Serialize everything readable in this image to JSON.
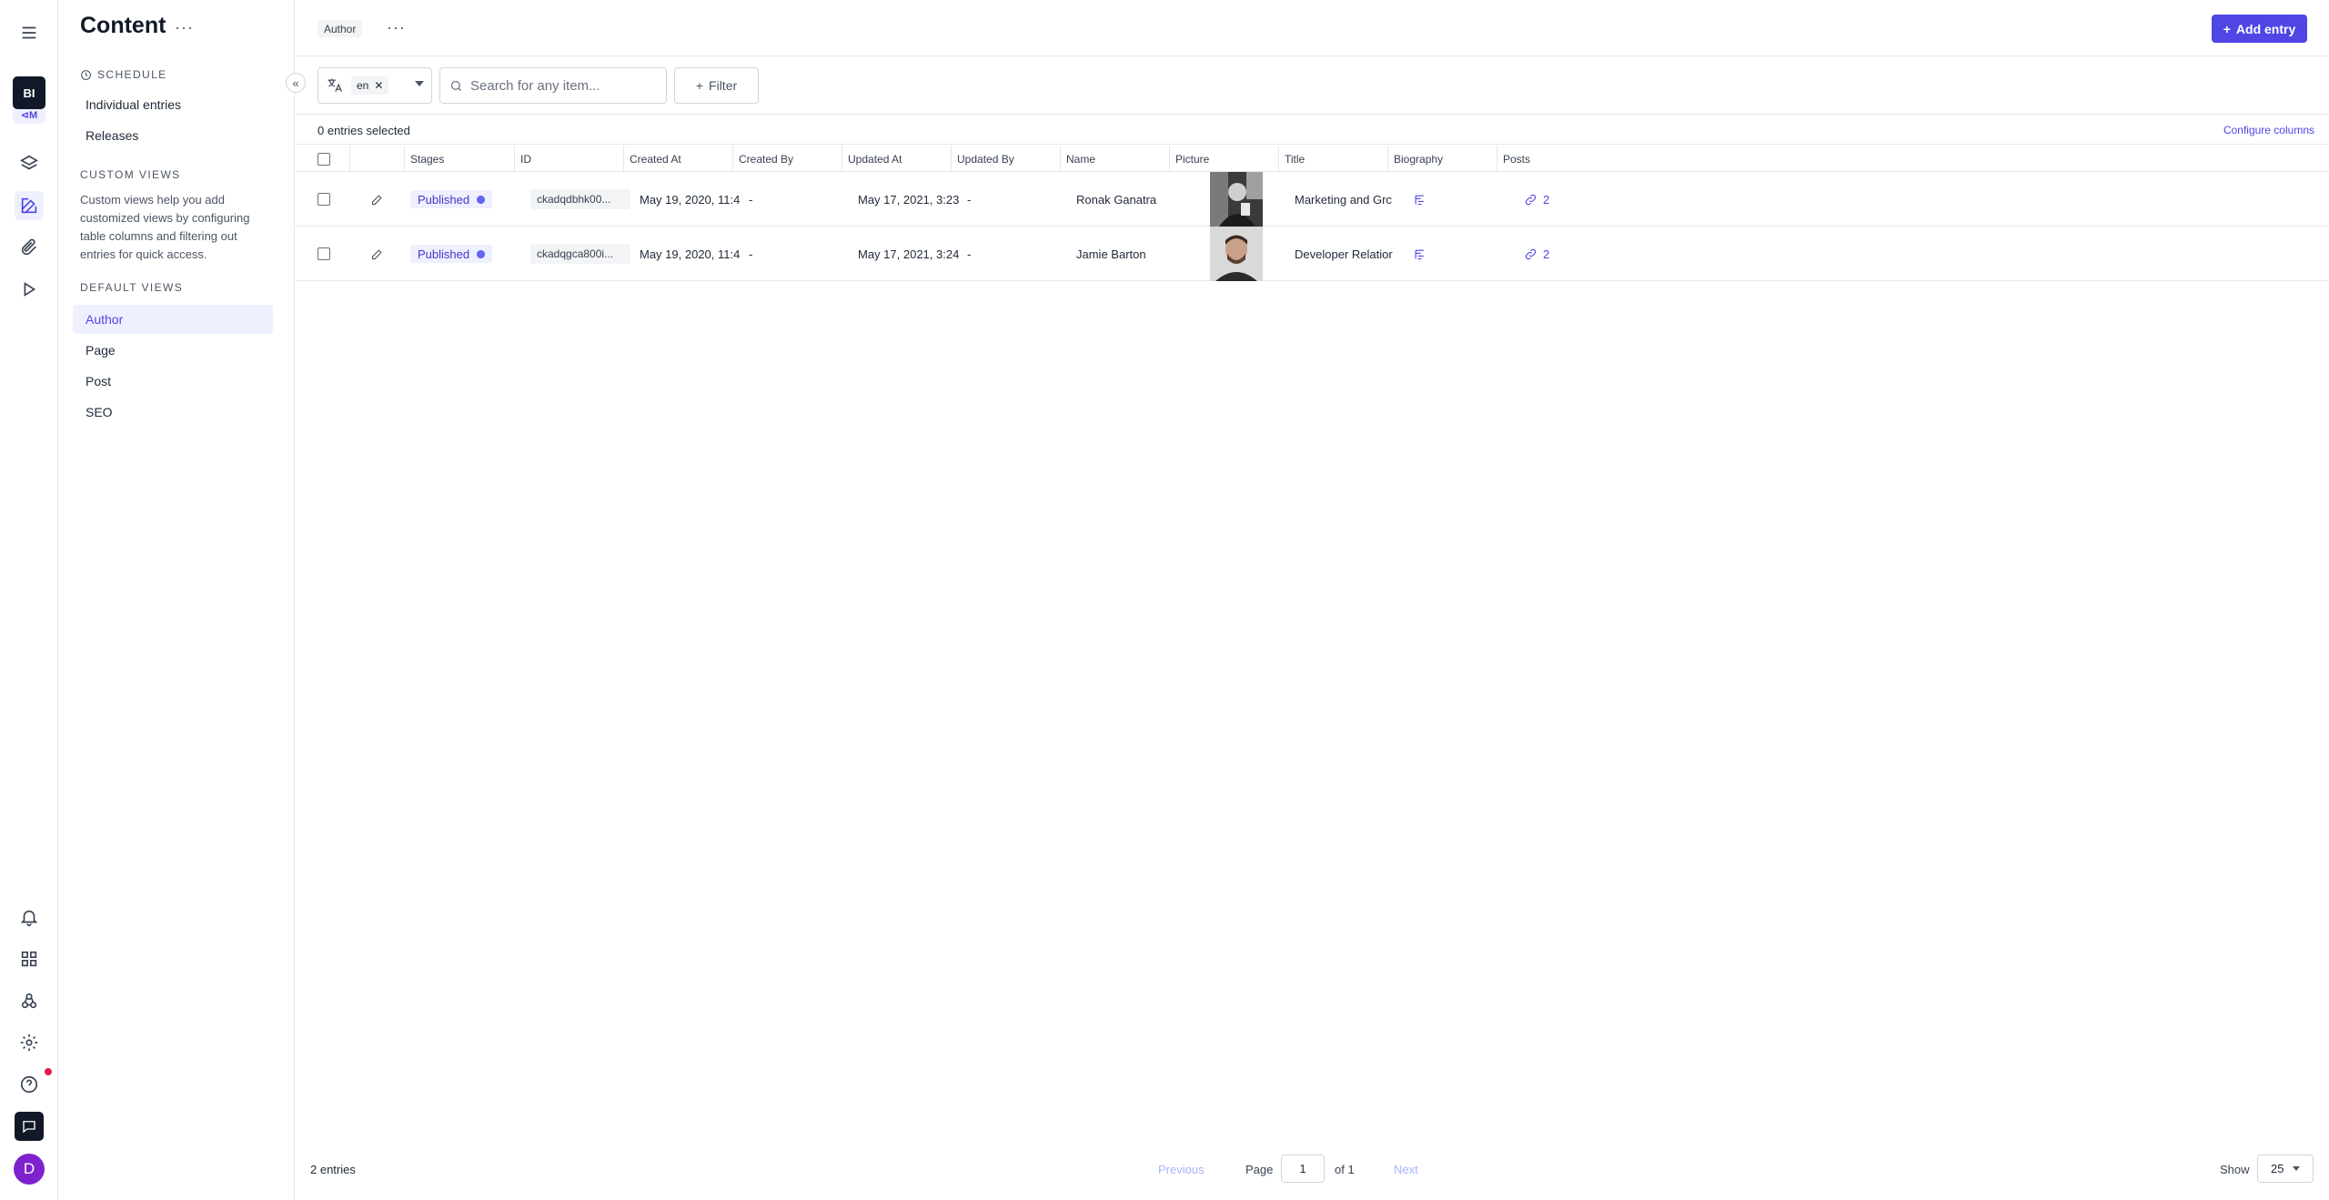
{
  "rail": {
    "project_badge": "BI",
    "project_sub": "⊲M"
  },
  "sidebar": {
    "title": "Content",
    "more": "···",
    "schedule_heading": "Schedule",
    "schedule_items": [
      {
        "label": "Individual entries"
      },
      {
        "label": "Releases"
      }
    ],
    "custom_views_heading": "Custom views",
    "custom_views_desc": "Custom views help you add customized views by configuring table columns and filtering out entries for quick access.",
    "default_views_heading": "Default views",
    "default_views": [
      {
        "label": "Author",
        "active": true
      },
      {
        "label": "Page",
        "active": false
      },
      {
        "label": "Post",
        "active": false
      },
      {
        "label": "SEO",
        "active": false
      }
    ],
    "collapse_icon": "«"
  },
  "header": {
    "model_chip": "Author",
    "more": "···",
    "add_entry_label": "Add entry",
    "accent": "#4f46e5"
  },
  "toolbar": {
    "locale_value": "en",
    "search_placeholder": "Search for any item...",
    "filter_label": "Filter"
  },
  "selection": {
    "count_text": "0 entries selected",
    "configure_columns": "Configure columns"
  },
  "table": {
    "columns": [
      "Stages",
      "ID",
      "Created At",
      "Created By",
      "Updated At",
      "Updated By",
      "Name",
      "Picture",
      "Title",
      "Biography",
      "Posts"
    ],
    "rows": [
      {
        "stage": "Published",
        "id": "ckadqdbhk00...",
        "created_at": "May 19, 2020, 11:4",
        "created_by": "-",
        "updated_at": "May 17, 2021, 3:23",
        "updated_by": "-",
        "name": "Ronak Ganatra",
        "title": "Marketing and Grc",
        "posts": "2"
      },
      {
        "stage": "Published",
        "id": "ckadqgca800i...",
        "created_at": "May 19, 2020, 11:4",
        "created_by": "-",
        "updated_at": "May 17, 2021, 3:24",
        "updated_by": "-",
        "name": "Jamie Barton",
        "title": "Developer Relatior",
        "posts": "2"
      }
    ]
  },
  "footer": {
    "total": "2 entries",
    "previous": "Previous",
    "page_label": "Page",
    "page_value": "1",
    "of_label": "of 1",
    "next": "Next",
    "show_label": "Show",
    "show_value": "25"
  },
  "user": {
    "avatar_initial": "D"
  }
}
